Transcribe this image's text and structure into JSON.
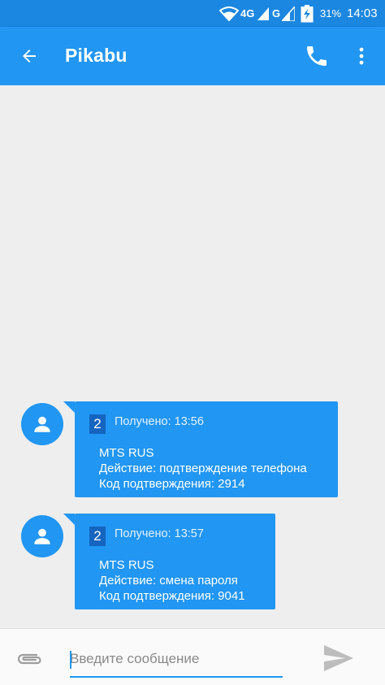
{
  "status_bar": {
    "network_4g": "4G",
    "network_g": "G",
    "battery": "31%",
    "time": "14:03"
  },
  "app_bar": {
    "title": "Pikabu",
    "back_icon": "arrow-back-icon",
    "call_icon": "phone-icon",
    "more_icon": "more-vert-icon"
  },
  "messages": [
    {
      "sim": "2",
      "received": "Получено: 13:56",
      "lines": [
        "MTS RUS",
        "Действие: подтверждение телефона",
        "Код подтверждения: 2914"
      ]
    },
    {
      "sim": "2",
      "received": "Получено: 13:57",
      "lines": [
        "MTS RUS",
        "Действие: смена пароля",
        "Код подтверждения: 9041"
      ]
    }
  ],
  "composer": {
    "placeholder": "Введите сообщение",
    "value": "",
    "attach_icon": "paperclip-icon",
    "send_icon": "send-icon"
  },
  "colors": {
    "primary": "#2196f3",
    "status_bar": "#1b87e0",
    "background": "#eeeeee"
  }
}
